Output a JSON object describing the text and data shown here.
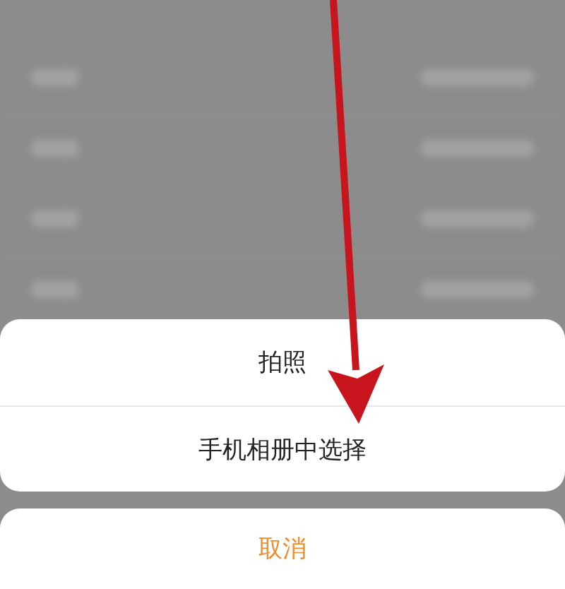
{
  "action_sheet": {
    "options": [
      {
        "label": "拍照"
      },
      {
        "label": "手机相册中选择"
      }
    ],
    "cancel": {
      "label": "取消"
    }
  }
}
